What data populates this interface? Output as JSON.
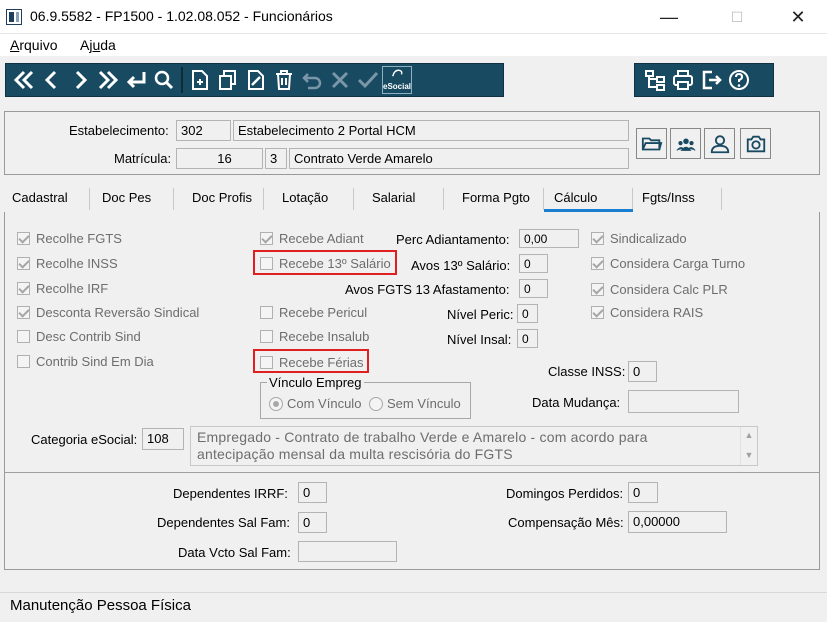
{
  "window": {
    "title": "06.9.5582 - FP1500 - 1.02.08.052 - Funcionários",
    "min_glyph": "—",
    "max_glyph": "☐",
    "close_glyph": "✕"
  },
  "menu": {
    "arquivo_u": "A",
    "arquivo_rest": "rquivo",
    "ajuda_pre": "Aj",
    "ajuda_u": "u",
    "ajuda_rest": "da"
  },
  "toolbar": {
    "esocial_label": "eSocial",
    "icons": [
      "first-icon",
      "prev-icon",
      "next-icon",
      "last-icon",
      "return-icon",
      "search-icon",
      "new-icon",
      "copy-icon",
      "edit-icon",
      "delete-icon",
      "undo-icon",
      "cancel-icon",
      "confirm-icon",
      "esocial-icon",
      "tree-icon",
      "print-icon",
      "exit-icon",
      "help-icon"
    ],
    "accent": "#184a62"
  },
  "header": {
    "estabelecimento_label": "Estabelecimento:",
    "estabelecimento_code": "302",
    "estabelecimento_name": "Estabelecimento 2 Portal HCM",
    "matricula_label": "Matrícula:",
    "matricula_value": "16",
    "contrato_code": "3",
    "contrato_name": "Contrato Verde Amarelo"
  },
  "tabs": [
    {
      "label": "Cadastral"
    },
    {
      "label": "Doc Pes"
    },
    {
      "label": "Doc Profis"
    },
    {
      "label": "Lotação"
    },
    {
      "label": "Salarial"
    },
    {
      "label": "Forma Pgto"
    },
    {
      "label": "Cálculo"
    },
    {
      "label": "Fgts/Inss"
    }
  ],
  "calculo": {
    "left_checks": [
      {
        "label": "Recolhe FGTS",
        "checked": true
      },
      {
        "label": "Recolhe INSS",
        "checked": true
      },
      {
        "label": "Recolhe IRF",
        "checked": true
      },
      {
        "label": "Desconta Reversão Sindical",
        "checked": true
      },
      {
        "label": "Desc Contrib Sind",
        "checked": false
      },
      {
        "label": "Contrib Sind Em Dia",
        "checked": false
      }
    ],
    "mid_checks": [
      {
        "label": "Recebe Adiant",
        "checked": true
      },
      {
        "label": "Recebe 13º Salário",
        "checked": false
      },
      {
        "label": "Recebe Pericul",
        "checked": false
      },
      {
        "label": "Recebe Insalub",
        "checked": false
      },
      {
        "label": "Recebe Férias",
        "checked": false
      }
    ],
    "right_checks": [
      {
        "label": "Sindicalizado",
        "checked": true
      },
      {
        "label": "Considera Carga Turno",
        "checked": true
      },
      {
        "label": "Considera Calc PLR",
        "checked": true
      },
      {
        "label": "Considera RAIS",
        "checked": true
      }
    ],
    "perc_adiant_label": "Perc Adiantamento:",
    "perc_adiant_value": "0,00",
    "avos13_label": "Avos 13º Salário:",
    "avos13_value": "0",
    "avos_fgts_label": "Avos FGTS 13 Afastamento:",
    "avos_fgts_value": "0",
    "nivel_peric_label": "Nível Peric:",
    "nivel_peric_value": "0",
    "nivel_insal_label": "Nível Insal:",
    "nivel_insal_value": "0",
    "classe_inss_label": "Classe INSS:",
    "classe_inss_value": "0",
    "data_mudanca_label": "Data Mudança:",
    "data_mudanca_value": "",
    "vinculo_title": "Vínculo Empreg",
    "vinculo_options": [
      {
        "label": "Com Vínculo",
        "selected": true
      },
      {
        "label": "Sem Vínculo",
        "selected": false
      }
    ],
    "categoria_label": "Categoria eSocial:",
    "categoria_code": "108",
    "categoria_desc_line1": "Empregado - Contrato de trabalho Verde e Amarelo - com acordo para",
    "categoria_desc_line2": "antecipação mensal da multa rescisória do FGTS",
    "scroll_up": "▲",
    "scroll_down": "▼"
  },
  "bottom": {
    "dep_irrf_label": "Dependentes IRRF:",
    "dep_irrf_value": "0",
    "dep_salfam_label": "Dependentes Sal Fam:",
    "dep_salfam_value": "0",
    "data_vcto_label": "Data Vcto Sal Fam:",
    "data_vcto_value": "",
    "domingos_label": "Domingos Perdidos:",
    "domingos_value": "0",
    "compensacao_label": "Compensação Mês:",
    "compensacao_value": "0,00000"
  },
  "status": {
    "text": "Manutenção Pessoa Física"
  },
  "colors": {
    "toolbar_bg": "#184a62",
    "active_tab_line": "#1a7fd0",
    "highlight_box": "#e02020"
  }
}
